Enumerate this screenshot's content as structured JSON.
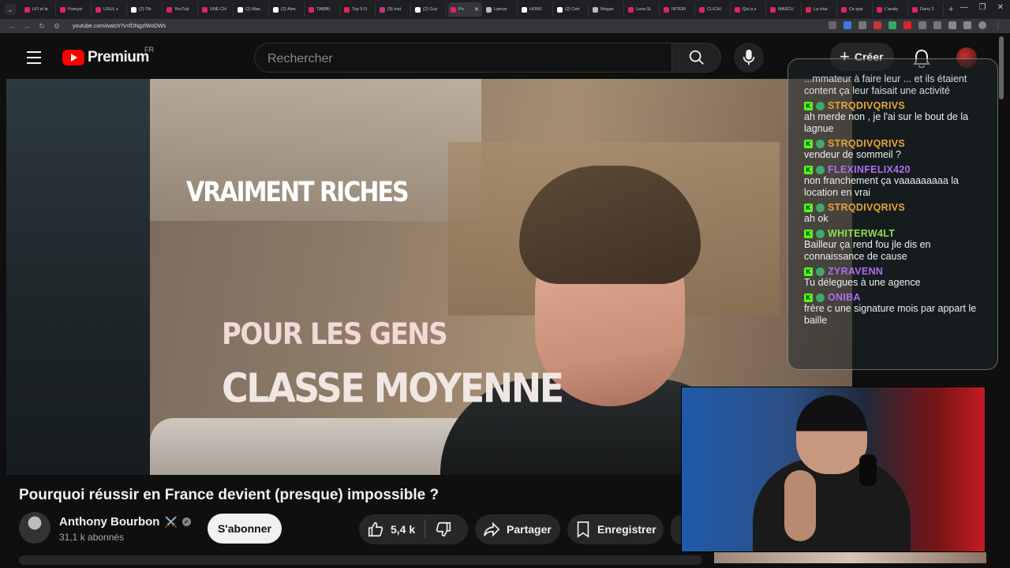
{
  "browser": {
    "tabs": [
      {
        "label": "LFI et le",
        "color": "#e0245e"
      },
      {
        "label": "Françoi",
        "color": "#e0245e"
      },
      {
        "label": "USUL s",
        "color": "#e0245e"
      },
      {
        "label": "(2) Tib",
        "color": "#ffffff"
      },
      {
        "label": "YouTub",
        "color": "#e0245e"
      },
      {
        "label": "UNE CH",
        "color": "#e0245e"
      },
      {
        "label": "(2) Man",
        "color": "#ffffff"
      },
      {
        "label": "(2) Alex",
        "color": "#ffffff"
      },
      {
        "label": "TABIBI",
        "color": "#e0245e"
      },
      {
        "label": "Top 5 D",
        "color": "#e0245e"
      },
      {
        "label": "(9) Inst",
        "color": "#c13584"
      },
      {
        "label": "(2) Guy",
        "color": "#ffffff"
      },
      {
        "label": "Po",
        "color": "#e0245e",
        "active": true
      },
      {
        "label": "Lancer",
        "color": "#bbbbbb"
      },
      {
        "label": "HOMJ",
        "color": "#ffffff"
      },
      {
        "label": "(2) Cert",
        "color": "#ffffff"
      },
      {
        "label": "Megan",
        "color": "#bbbbbb"
      },
      {
        "label": "Lena Si",
        "color": "#e0245e"
      },
      {
        "label": "INTERI",
        "color": "#e0245e"
      },
      {
        "label": "CLICHI",
        "color": "#e0245e"
      },
      {
        "label": "Qui a s",
        "color": "#e0245e"
      },
      {
        "label": "MASCU",
        "color": "#e0245e"
      },
      {
        "label": "La chai",
        "color": "#e0245e"
      },
      {
        "label": "Ce que",
        "color": "#e0245e"
      },
      {
        "label": "L'analy",
        "color": "#e0245e"
      },
      {
        "label": "Dany 2",
        "color": "#e0245e"
      }
    ],
    "url": "youtube.com/watch?v=fDNgzlWoDWs"
  },
  "header": {
    "logo_text": "Premium",
    "logo_region": "FR",
    "search_placeholder": "Rechercher",
    "create_label": "Créer"
  },
  "video": {
    "overlay_title": "VRAIMENT RICHES",
    "overlay_line1": "POUR LES GENS",
    "overlay_line2": "CLASSE MOYENNE",
    "title": "Pourquoi réussir en France devient (presque) impossible ?"
  },
  "channel": {
    "name": "Anthony Bourbon",
    "emoji": "⚔️",
    "subscribers": "31,1 k abonnés",
    "subscribe_label": "S'abonner"
  },
  "actions": {
    "likes": "5,4 k",
    "share_label": "Partager",
    "save_label": "Enregistrer"
  },
  "chat": {
    "partial_text": "...mmateur à faire leur ... et ils étaient content ça leur faisait une activité",
    "messages": [
      {
        "user": "STRQDIVQRIVS",
        "color": "#e8a33c",
        "text": "ah merde non , je l'ai sur le bout de la lagnue"
      },
      {
        "user": "STRQDIVQRIVS",
        "color": "#e8a33c",
        "text": "vendeur de sommeil ?"
      },
      {
        "user": "FLEXINFELIX420",
        "color": "#b06cf0",
        "text": "non franchement ça vaaaaaaaaa la location en vrai"
      },
      {
        "user": "STRQDIVQRIVS",
        "color": "#e8a33c",
        "text": "ah ok"
      },
      {
        "user": "WHITERW4LT",
        "color": "#8fe04a",
        "text": "Bailleur ça rend fou jle dis en connaissance de cause"
      },
      {
        "user": "ZYRAVENN",
        "color": "#b06cf0",
        "text": "Tu délegues à une agence"
      },
      {
        "user": "ONIBA",
        "color": "#b06cf0",
        "text": "frère c une signature mois par appart le baille"
      }
    ]
  }
}
